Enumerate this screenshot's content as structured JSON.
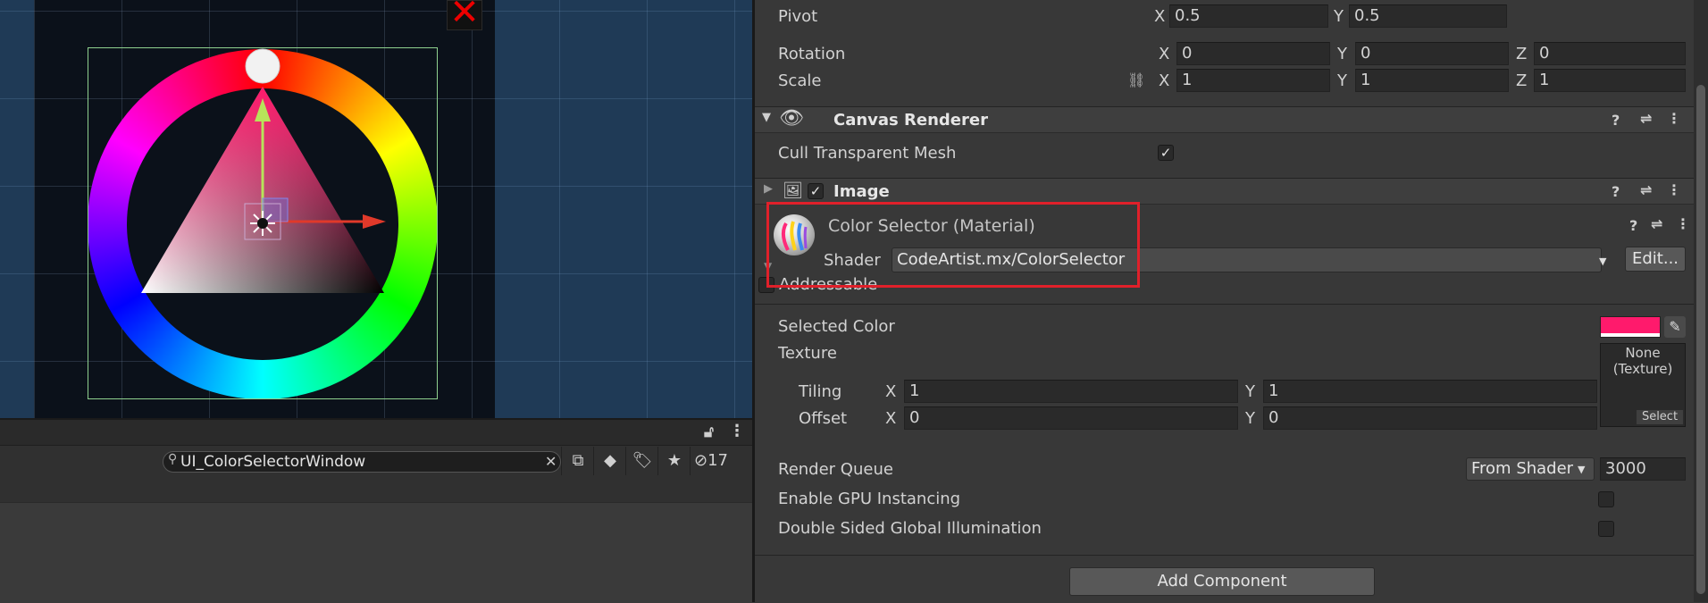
{
  "scene": {
    "close_icon": "close-x-icon"
  },
  "project": {
    "search_value": "UI_ColorSelectorWindow",
    "hidden_count": "17"
  },
  "transform": {
    "pivot_label": "Pivot",
    "pivot_x": "0.5",
    "pivot_y": "0.5",
    "rotation_label": "Rotation",
    "rotation_x": "0",
    "rotation_y": "0",
    "rotation_z": "0",
    "scale_label": "Scale",
    "scale_x": "1",
    "scale_y": "1",
    "scale_z": "1",
    "axis_x": "X",
    "axis_y": "Y",
    "axis_z": "Z"
  },
  "canvas_renderer": {
    "title": "Canvas Renderer",
    "cull_label": "Cull Transparent Mesh",
    "cull_checked": true
  },
  "image": {
    "title": "Image"
  },
  "material": {
    "name": "Color Selector (Material)",
    "shader_label": "Shader",
    "shader_value": "CodeArtist.mx/ColorSelector",
    "edit_label": "Edit...",
    "addressable_label": "Addressable",
    "selected_color_label": "Selected Color",
    "selected_color": "#ff1a6c",
    "texture_label": "Texture",
    "texture_none": "None",
    "texture_type": "(Texture)",
    "select_label": "Select",
    "tiling_label": "Tiling",
    "tiling_x": "1",
    "tiling_y": "1",
    "offset_label": "Offset",
    "offset_x": "0",
    "offset_y": "0",
    "render_queue_label": "Render Queue",
    "render_queue_mode": "From Shader",
    "render_queue_value": "3000",
    "gpu_instancing_label": "Enable GPU Instancing",
    "double_sided_label": "Double Sided Global Illumination"
  },
  "add_component_label": "Add Component",
  "colors": {
    "highlight_box": "#e0202a",
    "gizmo_y": "#b7e35a",
    "gizmo_x": "#e0392a"
  }
}
